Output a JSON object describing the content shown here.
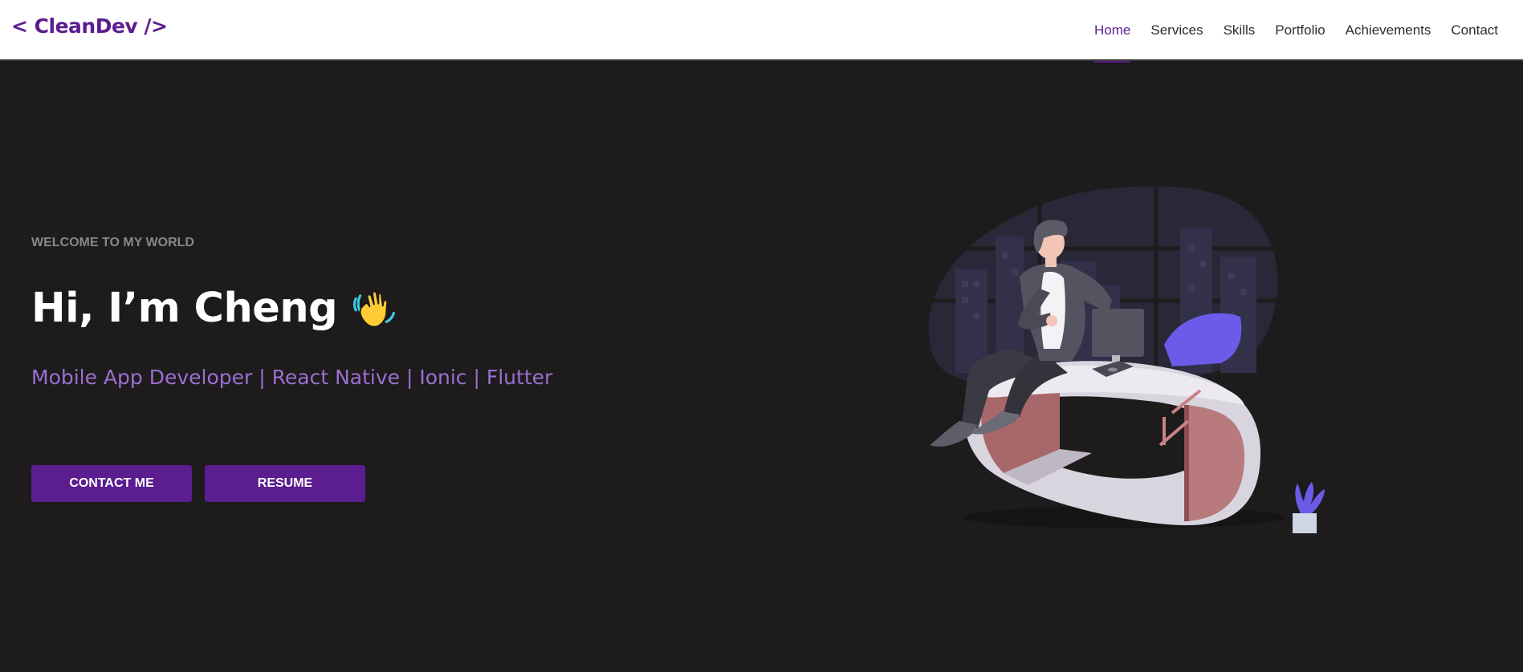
{
  "header": {
    "logo": "< CleanDev />",
    "nav": [
      {
        "label": "Home",
        "active": true
      },
      {
        "label": "Services",
        "active": false
      },
      {
        "label": "Skills",
        "active": false
      },
      {
        "label": "Portfolio",
        "active": false
      },
      {
        "label": "Achievements",
        "active": false
      },
      {
        "label": "Contact",
        "active": false
      }
    ]
  },
  "hero": {
    "welcome": "WELCOME TO MY WORLD",
    "greeting": "Hi, I’m Cheng",
    "wave_icon": "waving-hand-icon",
    "subtitle": "Mobile App Developer | React Native | Ionic | Flutter",
    "buttons": {
      "contact": "CONTACT ME",
      "resume": "RESUME"
    },
    "illustration": "developer-at-desk-illustration"
  },
  "colors": {
    "accent": "#5b1d8f",
    "subtitle": "#9d6fd1",
    "background": "#1d1b1c",
    "header_bg": "#ffffff"
  }
}
